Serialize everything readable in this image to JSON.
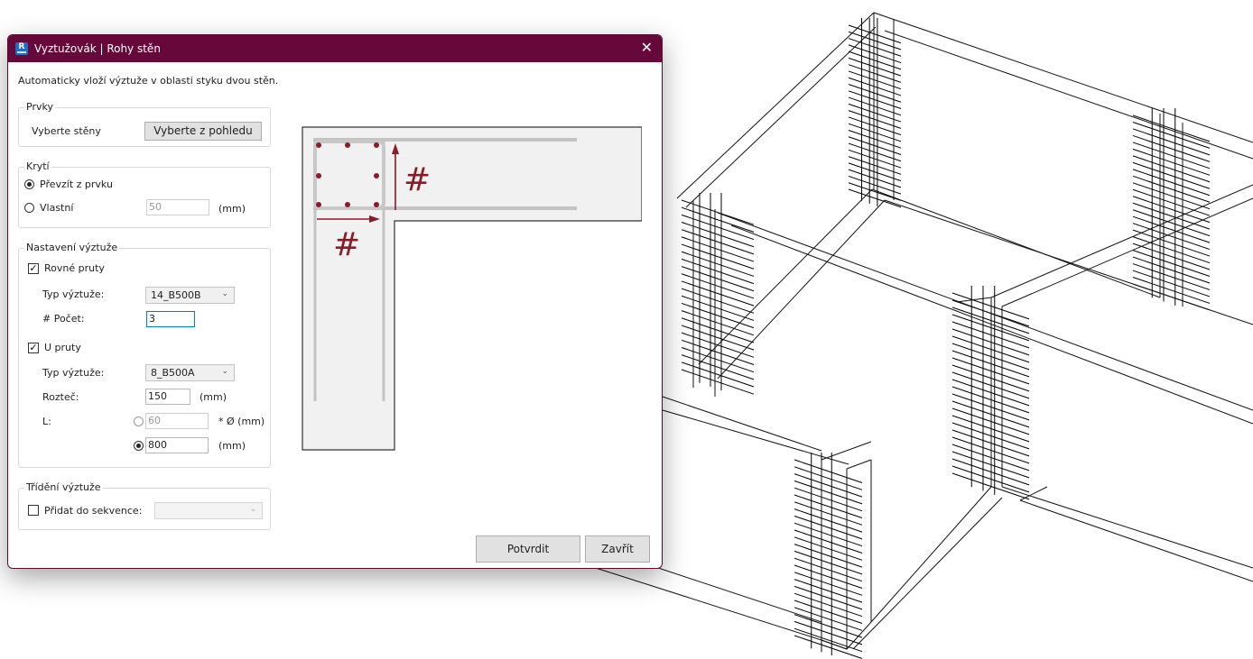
{
  "dialog": {
    "title": "Vyztužovák | Rohy stěn",
    "app_icon_letter": "R",
    "close_glyph": "✕",
    "description": "Automaticky vloží výztuže v oblasti styku dvou stěn."
  },
  "prvky": {
    "legend": "Prvky",
    "select_walls_label": "Vyberte stěny",
    "select_button": "Vyberte z pohledu"
  },
  "kryti": {
    "legend": "Krytí",
    "from_element_label": "Převzít z prvku",
    "from_element_selected": true,
    "custom_label": "Vlastní",
    "custom_value": "50",
    "unit": "(mm)"
  },
  "nastaveni": {
    "legend": "Nastavení výztuže",
    "straight": {
      "label": "Rovné pruty",
      "checked": true,
      "check_glyph": "✓",
      "type_label": "Typ výztuže:",
      "type_value": "14_B500B",
      "count_label": "# Počet:",
      "count_value": "3"
    },
    "u_bars": {
      "label": "U pruty",
      "checked": true,
      "check_glyph": "✓",
      "type_label": "Typ výztuže:",
      "type_value": "8_B500A",
      "spacing_label": "Rozteč:",
      "spacing_value": "150",
      "spacing_unit": "(mm)",
      "length_label": "L:",
      "length_factor_value": "60",
      "length_factor_unit": "* Ø (mm)",
      "length_factor_selected": false,
      "length_mm_value": "800",
      "length_mm_unit": "(mm)",
      "length_mm_selected": true
    }
  },
  "trideni": {
    "legend": "Třídění výztuže",
    "add_to_sequence_label": "Přidat do sekvence:",
    "add_to_sequence_checked": false,
    "sequence_value": ""
  },
  "footer": {
    "confirm": "Potvrdit",
    "close": "Zavřít"
  },
  "preview": {
    "hash_symbol": "#"
  },
  "colors": {
    "title_bar": "#66093a",
    "rebar": "#8b1a2b",
    "wall_fill": "#f1f1f1"
  },
  "icons": {
    "dropdown": "chevron-down-icon",
    "close": "close-icon"
  }
}
